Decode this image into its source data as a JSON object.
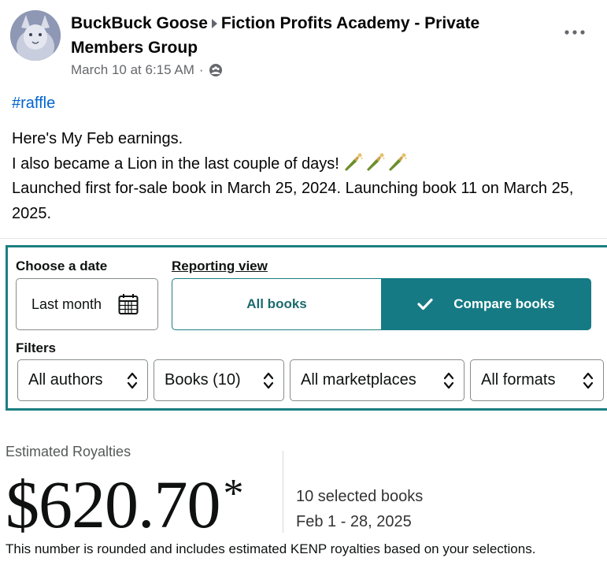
{
  "post": {
    "author": "BuckBuck Goose",
    "group": "Fiction Profits Academy - Private Members Group",
    "timestamp": "March 10 at 6:15 AM",
    "meta_separator": "·",
    "more_icon": "more-options-icon",
    "privacy_icon": "group-members-icon",
    "hashtag": "#raffle",
    "lines": [
      "Here's My Feb earnings.",
      "I also became a Lion in the last couple of days!",
      "Launched first for-sale book in March 25, 2024. Launching book 11 on March 25, 2025."
    ],
    "emoji": "bottle-with-popping-cork-icon"
  },
  "kdp": {
    "choose_date_label": "Choose a date",
    "date_value": "Last month",
    "reporting_view_label": "Reporting view",
    "view_all": "All books",
    "view_compare": "Compare books",
    "filters_label": "Filters",
    "filters": [
      "All authors",
      "Books (10)",
      "All marketplaces",
      "All formats"
    ],
    "accent_color": "#157a84",
    "estimated_label": "Estimated Royalties",
    "amount": "$620.70",
    "asterisk": "*",
    "selected_books": "10 selected books",
    "date_range": "Feb 1 - 28, 2025",
    "footnote": "This number is rounded and includes estimated KENP royalties based on your selections."
  }
}
